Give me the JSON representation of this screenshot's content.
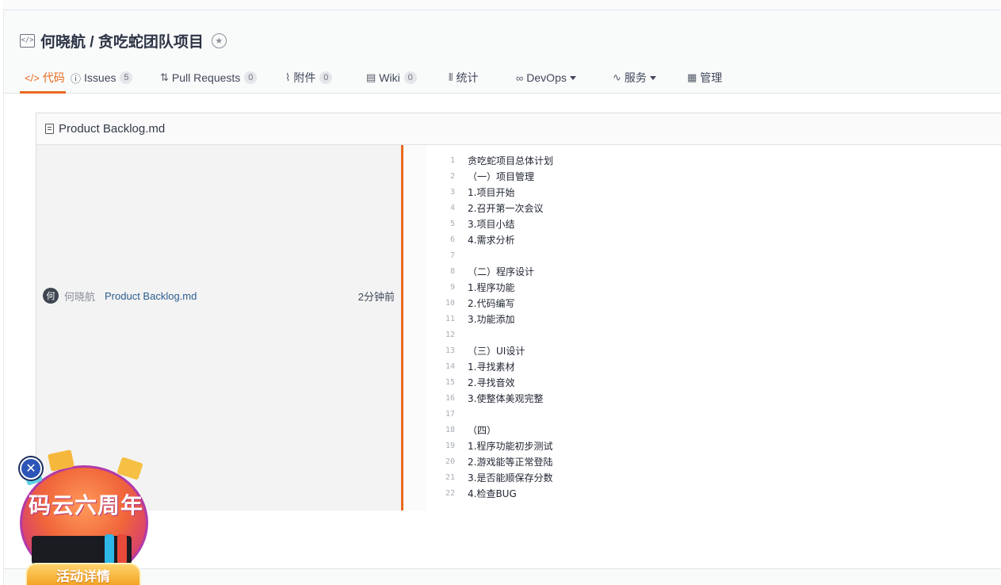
{
  "repo": {
    "title": "何晓航 / 贪吃蛇团队项目"
  },
  "tabs": [
    {
      "icon": "code-icon",
      "glyph": "</>",
      "label": "代码",
      "active": true
    },
    {
      "icon": "issue-icon",
      "glyph": "ⓘ",
      "label": "Issues",
      "count": "5"
    },
    {
      "icon": "pull-request-icon",
      "glyph": "⇅",
      "label": "Pull Requests",
      "count": "0"
    },
    {
      "icon": "attachment-icon",
      "glyph": "⌇",
      "label": "附件",
      "count": "0"
    },
    {
      "icon": "wiki-icon",
      "glyph": "▤",
      "label": "Wiki",
      "count": "0"
    },
    {
      "icon": "stats-icon",
      "glyph": "⫴",
      "label": "统计"
    },
    {
      "icon": "devops-icon",
      "glyph": "∞",
      "label": "DevOps",
      "dropdown": true
    },
    {
      "icon": "service-icon",
      "glyph": "∿",
      "label": "服务",
      "dropdown": true
    },
    {
      "icon": "manage-icon",
      "glyph": "▦",
      "label": "管理"
    }
  ],
  "file": {
    "name": "Product Backlog.md"
  },
  "blame": {
    "avatar_char": "何",
    "author": "何晓航",
    "commit_message": "Product Backlog.md",
    "time": "2分钟前"
  },
  "code_lines": [
    {
      "n": "1",
      "text": "贪吃蛇项目总体计划"
    },
    {
      "n": "2",
      "text": "（一）项目管理"
    },
    {
      "n": "3",
      "text": "1.项目开始"
    },
    {
      "n": "4",
      "text": "2.召开第一次会议"
    },
    {
      "n": "5",
      "text": "3.项目小结"
    },
    {
      "n": "6",
      "text": "4.需求分析"
    },
    {
      "n": "7",
      "text": ""
    },
    {
      "n": "8",
      "text": "（二）程序设计"
    },
    {
      "n": "9",
      "text": "1.程序功能"
    },
    {
      "n": "10",
      "text": "2.代码编写"
    },
    {
      "n": "11",
      "text": "3.功能添加"
    },
    {
      "n": "12",
      "text": ""
    },
    {
      "n": "13",
      "text": "（三）UI设计"
    },
    {
      "n": "14",
      "text": "1.寻找素材"
    },
    {
      "n": "15",
      "text": "2.寻找音效"
    },
    {
      "n": "16",
      "text": "3.使整体美观完整"
    },
    {
      "n": "17",
      "text": ""
    },
    {
      "n": "18",
      "text": "（四）"
    },
    {
      "n": "19",
      "text": "1.程序功能初步测试"
    },
    {
      "n": "20",
      "text": "2.游戏能等正常登陆"
    },
    {
      "n": "21",
      "text": "3.是否能顺保存分数"
    },
    {
      "n": "22",
      "text": "4.检查BUG"
    }
  ],
  "promo": {
    "title": "码云六周年",
    "button": "活动详情",
    "close": "✕"
  },
  "colors": {
    "accent": "#e96a1f",
    "link": "#2b5e8e"
  }
}
